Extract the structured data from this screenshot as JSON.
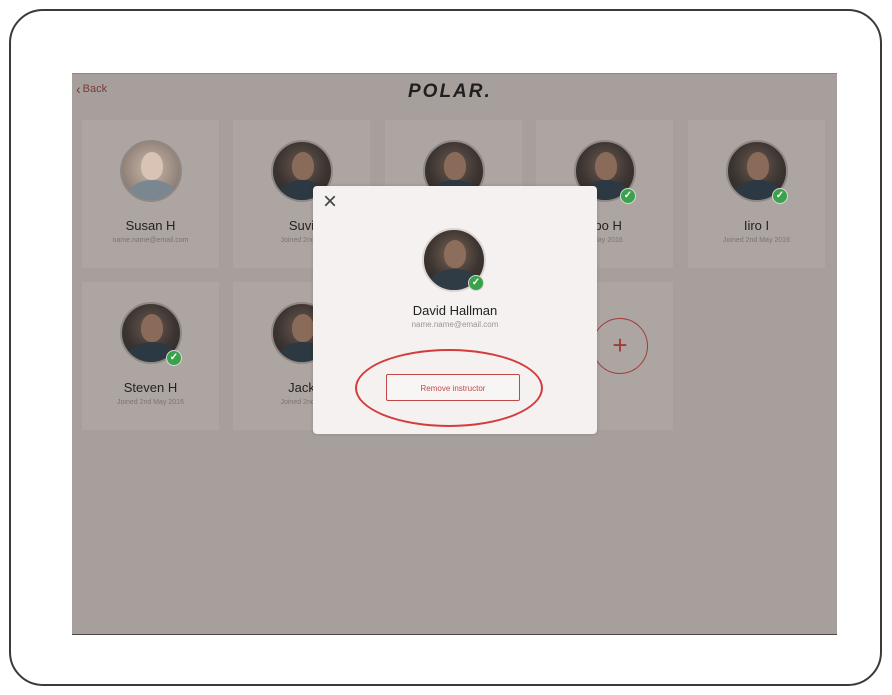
{
  "header": {
    "back_label": "Back",
    "logo_text": "POLAR.",
    "logo_accent_color": "#b02a2a"
  },
  "members": [
    {
      "name": "Susan H",
      "subtitle": "name.name@email.com",
      "verified": false
    },
    {
      "name": "Suvi",
      "subtitle": "Joined 2nd M",
      "verified": false
    },
    {
      "name": "",
      "subtitle": "",
      "verified": false
    },
    {
      "name": "opo H",
      "subtitle": "d May 2016",
      "verified": true
    },
    {
      "name": "Iiro I",
      "subtitle": "Joined 2nd May 2016",
      "verified": true
    },
    {
      "name": "Steven H",
      "subtitle": "Joined 2nd May 2016",
      "verified": true
    },
    {
      "name": "Jack",
      "subtitle": "Joined 2nd M",
      "verified": false
    }
  ],
  "add_button_label": "+",
  "modal": {
    "close_label": "×",
    "name": "David Hallman",
    "email": "name.name@email.com",
    "verified": true,
    "remove_button_label": "Remove instructor"
  },
  "icons": {
    "check": "✓"
  },
  "colors": {
    "accent": "#c14848",
    "verified": "#3aa24a",
    "highlight": "#d23c3c"
  }
}
